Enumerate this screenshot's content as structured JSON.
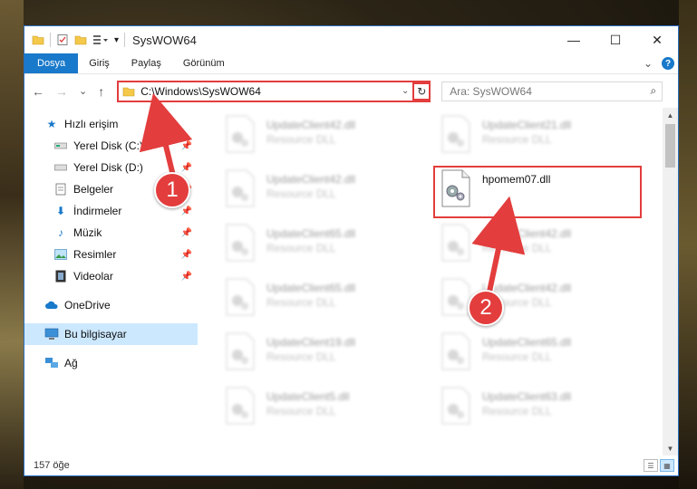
{
  "window": {
    "title": "SysWOW64",
    "controls": {
      "minimize": "—",
      "maximize": "☐",
      "close": "✕"
    }
  },
  "ribbon": {
    "tabs": [
      "Dosya",
      "Giriş",
      "Paylaş",
      "Görünüm"
    ],
    "expand": "⌄",
    "help": "?"
  },
  "nav": {
    "back": "←",
    "forward": "→",
    "recent": "⌄",
    "up": "↑"
  },
  "address": {
    "path": "C:\\Windows\\SysWOW64",
    "dropdown": "⌄",
    "refresh": "↻"
  },
  "search": {
    "placeholder": "Ara: SysWOW64",
    "icon": "⌕"
  },
  "sidebar": {
    "items": [
      {
        "label": "Hızlı erişim",
        "icon": "star-icon",
        "pinned": false
      },
      {
        "label": "Yerel Disk (C:)",
        "icon": "drive-icon",
        "pinned": true
      },
      {
        "label": "Yerel Disk (D:)",
        "icon": "drive-icon",
        "pinned": true
      },
      {
        "label": "Belgeler",
        "icon": "documents-icon",
        "pinned": true
      },
      {
        "label": "İndirmeler",
        "icon": "download-icon",
        "pinned": true
      },
      {
        "label": "Müzik",
        "icon": "music-icon",
        "pinned": true
      },
      {
        "label": "Resimler",
        "icon": "pictures-icon",
        "pinned": true
      },
      {
        "label": "Videolar",
        "icon": "videos-icon",
        "pinned": true
      },
      {
        "label": "OneDrive",
        "icon": "cloud-icon",
        "pinned": false
      },
      {
        "label": "Bu bilgisayar",
        "icon": "computer-icon",
        "pinned": false
      },
      {
        "label": "Ağ",
        "icon": "network-icon",
        "pinned": false
      }
    ]
  },
  "files": {
    "left": [
      {
        "name": "UpdateClient42.dll",
        "type": "Resource DLL"
      },
      {
        "name": "UpdateClient42.dll",
        "type": "Resource DLL"
      },
      {
        "name": "UpdateClient65.dll",
        "type": "Resource DLL"
      },
      {
        "name": "UpdateClient65.dll",
        "type": "Resource DLL"
      },
      {
        "name": "UpdateClient19.dll",
        "type": "Resource DLL"
      },
      {
        "name": "UpdateClient5.dll",
        "type": "Resource DLL"
      }
    ],
    "right": [
      {
        "name": "UpdateClient21.dll",
        "type": "Resource DLL",
        "highlight": false
      },
      {
        "name": "hpomem07.dll",
        "type": "",
        "highlight": true
      },
      {
        "name": "UpdateClient42.dll",
        "type": "Resource DLL",
        "highlight": false
      },
      {
        "name": "UpdateClient42.dll",
        "type": "Resource DLL",
        "highlight": false
      },
      {
        "name": "UpdateClient65.dll",
        "type": "Resource DLL",
        "highlight": false
      },
      {
        "name": "UpdateClient63.dll",
        "type": "Resource DLL",
        "highlight": false
      }
    ]
  },
  "status": {
    "count": "157 öğe"
  },
  "annotations": {
    "badge1": "1",
    "badge2": "2",
    "color": "#e33d3d"
  },
  "colors": {
    "accent": "#1979ca",
    "selected": "#cce8ff",
    "highlight": "#e33d3d"
  }
}
